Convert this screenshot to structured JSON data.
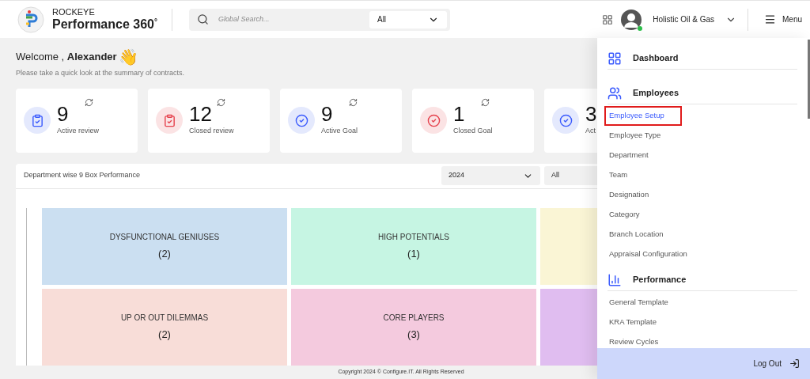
{
  "brand": {
    "top": "ROCKEYE",
    "name": "Performance 360",
    "degree": "°"
  },
  "search": {
    "placeholder": "Global Search...",
    "scope": "All"
  },
  "user": {
    "company": "Holistic Oil & Gas",
    "online": true
  },
  "menu_button": "Menu",
  "welcome": {
    "greeting": "Welcome , ",
    "name": "Alexander",
    "emoji": "👋",
    "subtitle": "Please take a quick look at the summary of contracts."
  },
  "cards": [
    {
      "value": "9",
      "label": "Active review",
      "kind": "review",
      "color": "#3b5bfd",
      "refresh": true
    },
    {
      "value": "12",
      "label": "Closed review",
      "kind": "review",
      "color": "#e5424d",
      "refresh": true
    },
    {
      "value": "9",
      "label": "Active Goal",
      "kind": "goal",
      "color": "#3b5bfd",
      "refresh": true
    },
    {
      "value": "1",
      "label": "Closed Goal",
      "kind": "goal",
      "color": "#e5424d",
      "refresh": true
    },
    {
      "value": "3",
      "label": "Act",
      "kind": "goal",
      "color": "#3b5bfd"
    }
  ],
  "panel": {
    "title": "Department wise 9 Box Performance",
    "year": "2024",
    "filter": "All",
    "boxes": [
      {
        "label": "DYSFUNCTIONAL GENIUSES",
        "count": "(2)",
        "color": "#cbdff1"
      },
      {
        "label": "HIGH POTENTIALS",
        "count": "(1)",
        "color": "#c6f5e3"
      },
      {
        "color": "#faf5d5"
      },
      {
        "label": "UP OR OUT DILEMMAS",
        "count": "(2)",
        "color": "#f8ddd8"
      },
      {
        "label": "CORE PLAYERS",
        "count": "(3)",
        "color": "#f4cade"
      },
      {
        "color": "#e0bdf0"
      }
    ]
  },
  "footer": "Copyright 2024 © Configure.IT. All Rights Reserved",
  "menu": {
    "sections": [
      {
        "title": "Dashboard",
        "kind": "dashboard"
      },
      {
        "title": "Employees",
        "kind": "employees",
        "items": [
          {
            "label": "Employee Setup",
            "selected": true
          },
          {
            "label": "Employee Type",
            "selected": false
          },
          {
            "label": "Department",
            "selected": false
          },
          {
            "label": "Team",
            "selected": false
          },
          {
            "label": "Designation",
            "selected": false
          },
          {
            "label": "Category",
            "selected": false
          },
          {
            "label": "Branch Location",
            "selected": false
          },
          {
            "label": "Appraisal Configuration",
            "selected": false
          }
        ]
      },
      {
        "title": "Performance",
        "kind": "performance",
        "items": [
          {
            "label": "General Template",
            "selected": false
          },
          {
            "label": "KRA Template",
            "selected": false
          },
          {
            "label": "Review Cycles",
            "selected": false
          }
        ]
      }
    ],
    "logout": "Log Out"
  }
}
